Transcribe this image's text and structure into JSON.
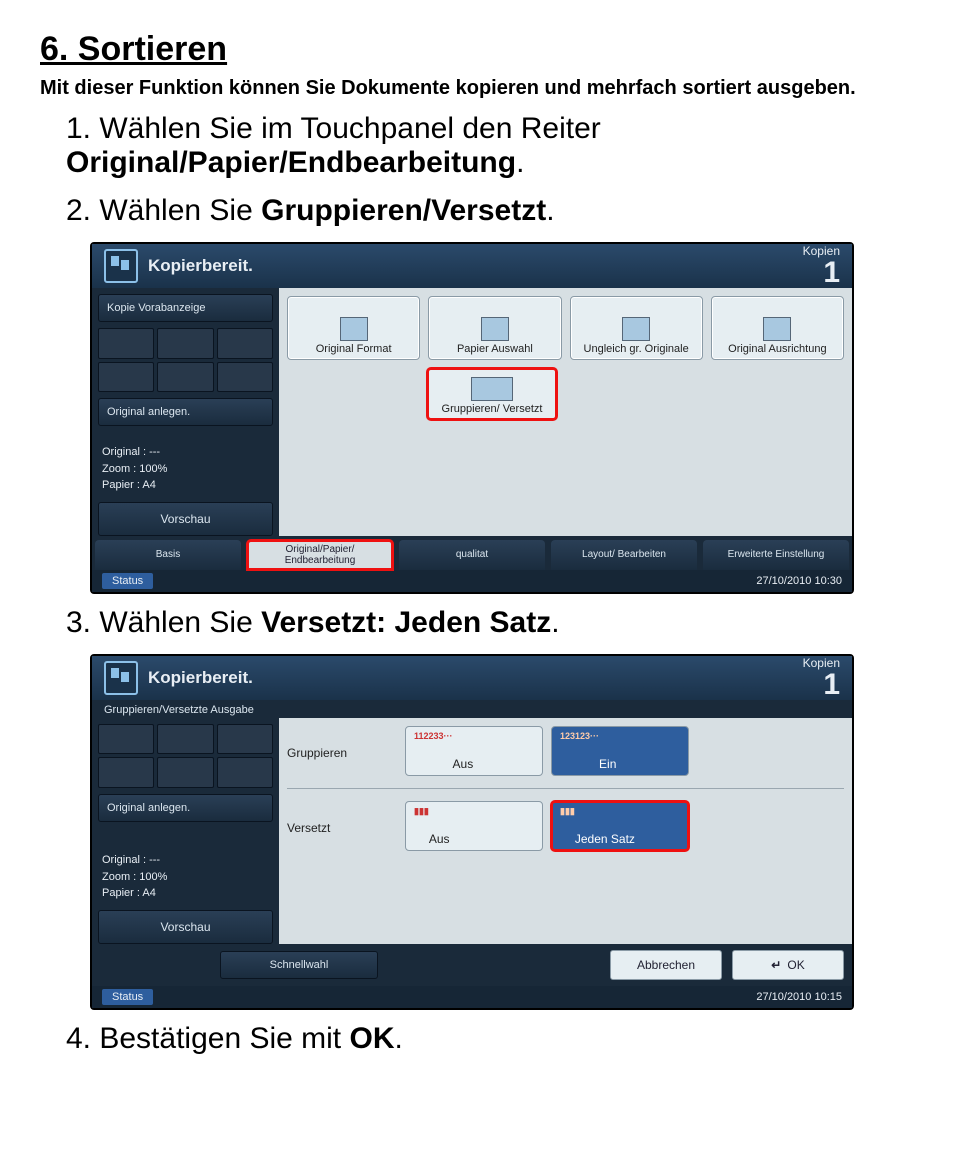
{
  "doc": {
    "h1": "6. Sortieren",
    "intro": "Mit dieser Funktion können Sie Dokumente kopieren und mehrfach sortiert ausgeben.",
    "step1_pre": "1. Wählen Sie im Touchpanel den Reiter ",
    "step1_bold": "Original/Papier/Endbearbeitung",
    "step2_pre": "2. Wählen Sie ",
    "step2_bold": "Gruppieren/Versetzt",
    "step3_pre": "3. Wählen Sie ",
    "step3_bold": "Versetzt: Jeden Satz",
    "step4_pre": "4. Bestätigen Sie mit ",
    "step4_bold": "OK",
    "period": "."
  },
  "panel": {
    "title": "Kopierbereit.",
    "copies_label": "Kopien",
    "copies_count": "1",
    "side_preview_label": "Kopie Vorabanzeige",
    "side_place_label": "Original anlegen.",
    "side_status_labels": {
      "original": "Original",
      "zoom": "Zoom",
      "paper": "Papier"
    },
    "side_status_values": {
      "original": "---",
      "zoom": "100%",
      "paper": "A4"
    },
    "side_preview_btn": "Vorschau",
    "status_chip": "Status",
    "tabs": [
      "Basis",
      "Original/Papier/ Endbearbeitung",
      "qualitat",
      "Layout/ Bearbeiten",
      "Erweiterte Einstellung"
    ],
    "screen1": {
      "opts": [
        "Original Format",
        "Papier Auswahl",
        "Ungleich gr. Originale",
        "Original Ausrichtung"
      ],
      "group_btn": "Gruppieren/ Versetzt",
      "datetime": "27/10/2010   10:30"
    },
    "screen2": {
      "subheader": "Gruppieren/Versetzte Ausgabe",
      "row1_label": "Gruppieren",
      "row1_icons": [
        "112233···",
        "123123···"
      ],
      "row1_aus": "Aus",
      "row1_ein": "Ein",
      "row2_label": "Versetzt",
      "row2_aus": "Aus",
      "row2_jeden": "Jeden Satz",
      "schnellwahl": "Schnellwahl",
      "cancel": "Abbrechen",
      "ok": "OK",
      "enter_icon": "↵",
      "datetime": "27/10/2010   10:15"
    }
  }
}
